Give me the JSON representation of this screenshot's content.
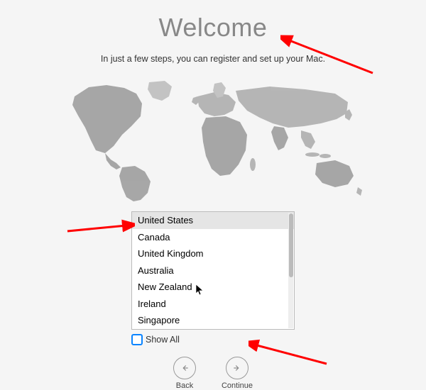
{
  "title": "Welcome",
  "subtitle": "In just a few steps, you can register and set up your Mac.",
  "countries": [
    "United States",
    "Canada",
    "United Kingdom",
    "Australia",
    "New Zealand",
    "Ireland",
    "Singapore"
  ],
  "selected_index": 0,
  "show_all_label": "Show All",
  "back_label": "Back",
  "continue_label": "Continue"
}
